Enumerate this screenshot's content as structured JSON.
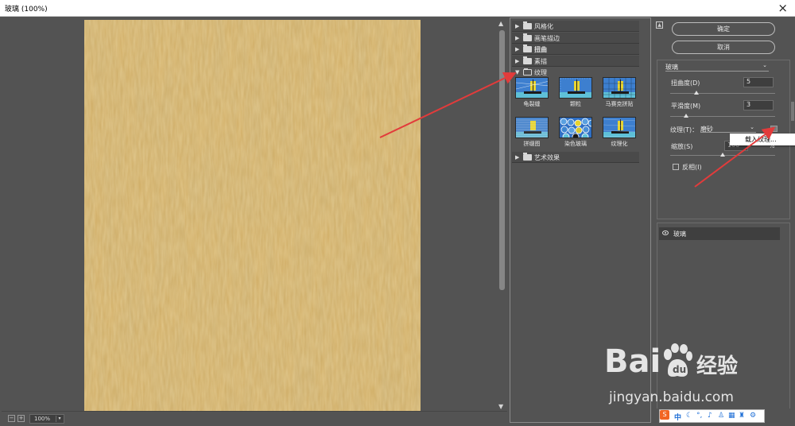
{
  "window": {
    "title": "玻璃 (100%)"
  },
  "zoom": {
    "value": "100%"
  },
  "filter_gallery": {
    "categories": [
      {
        "label": "风格化",
        "expanded": false
      },
      {
        "label": "画笔描边",
        "expanded": false
      },
      {
        "label": "扭曲",
        "expanded": false
      },
      {
        "label": "素描",
        "expanded": false
      },
      {
        "label": "纹理",
        "expanded": true
      },
      {
        "label": "艺术效果",
        "expanded": false
      }
    ],
    "texture_filters": [
      {
        "label": "龟裂缝"
      },
      {
        "label": "颗粒"
      },
      {
        "label": "马赛克拼贴"
      },
      {
        "label": "拼缀图"
      },
      {
        "label": "染色玻璃"
      },
      {
        "label": "纹理化"
      }
    ]
  },
  "buttons": {
    "ok": "确定",
    "cancel": "取消"
  },
  "settings": {
    "filter_name": "玻璃",
    "distortion_label": "扭曲度(D)",
    "distortion_value": "5",
    "distortion_level": 0.25,
    "smoothness_label": "平滑度(M)",
    "smoothness_value": "3",
    "smoothness_level": 0.15,
    "texture_label": "纹理(T)：",
    "texture_value": "磨砂",
    "scaling_label": "缩放(S)",
    "scaling_value": "100",
    "scaling_unit": "%",
    "scaling_level": 0.5,
    "invert_label": "反相(I)",
    "invert_checked": false,
    "popup_item": "载入纹理..."
  },
  "layers": {
    "items": [
      {
        "label": "玻璃",
        "visible": true
      }
    ]
  },
  "watermark": {
    "brand": "Bai",
    "brand_suffix": "经验",
    "url": "jingyan.baidu.com"
  },
  "ime": {
    "mode": "中"
  },
  "colors": {
    "background": "#535353",
    "canvas": "#d2ad63",
    "annotation_arrow": "#e23b3b"
  }
}
